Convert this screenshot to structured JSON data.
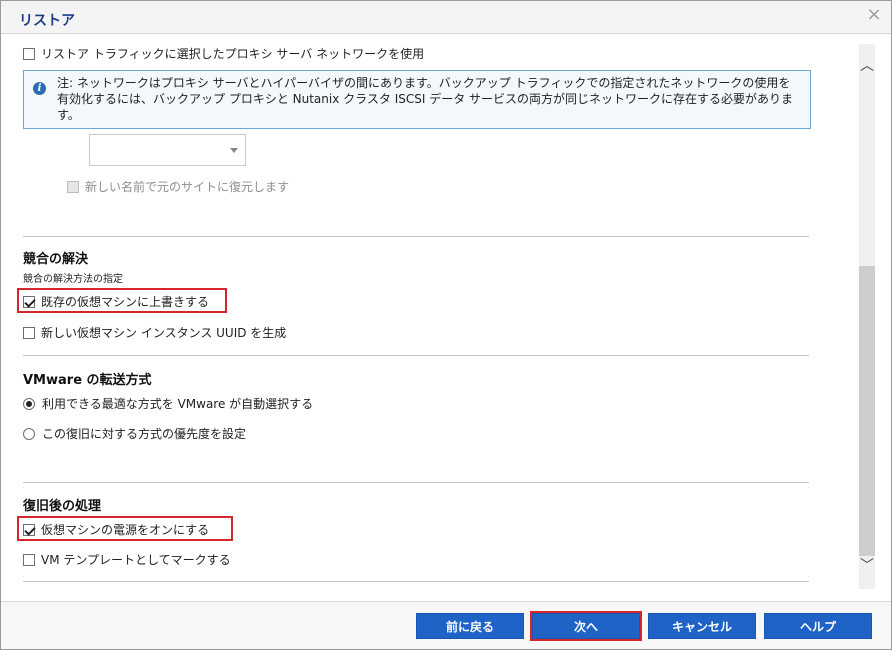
{
  "dialog": {
    "title": "リストア",
    "close_glyph": "×"
  },
  "network": {
    "use_proxy_network_label": "リストア トラフィックに選択したプロキシ サーバ ネットワークを使用",
    "note_icon_glyph": "i",
    "note_text": "注: ネットワークはプロキシ サーバとハイパーバイザの間にあります。バックアップ トラフィックでの指定されたネットワークの使用を有効化するには、バックアップ プロキシと Nutanix クラスタ ISCSI データ サービスの両方が同じネットワークに存在する必要があります。",
    "network_select_value": "",
    "restore_original_site_label": "新しい名前で元のサイトに復元します"
  },
  "conflict": {
    "title": "競合の解決",
    "subtitle": "競合の解決方法の指定",
    "overwrite_label": "既存の仮想マシンに上書きする",
    "overwrite_checked": true,
    "new_uuid_label": "新しい仮想マシン インスタンス UUID を生成",
    "new_uuid_checked": false
  },
  "transport": {
    "title": "VMware の転送方式",
    "auto_label": "利用できる最適な方式を VMware が自動選択する",
    "priority_label": "この復旧に対する方式の優先度を設定",
    "selected": "auto"
  },
  "post_recovery": {
    "title": "復旧後の処理",
    "power_on_label": "仮想マシンの電源をオンにする",
    "power_on_checked": true,
    "template_label": "VM テンプレートとしてマークする",
    "template_checked": false
  },
  "scrollbar": {
    "up_glyph": "︿",
    "down_glyph": "﹀"
  },
  "footer": {
    "back_label": "前に戻る",
    "next_label": "次へ",
    "cancel_label": "キャンセル",
    "help_label": "ヘルプ"
  },
  "colors": {
    "accent_button": "#1f63c7",
    "title_text": "#1b3d87",
    "highlight_box": "#d6262a",
    "note_border": "#6aa8d9"
  }
}
